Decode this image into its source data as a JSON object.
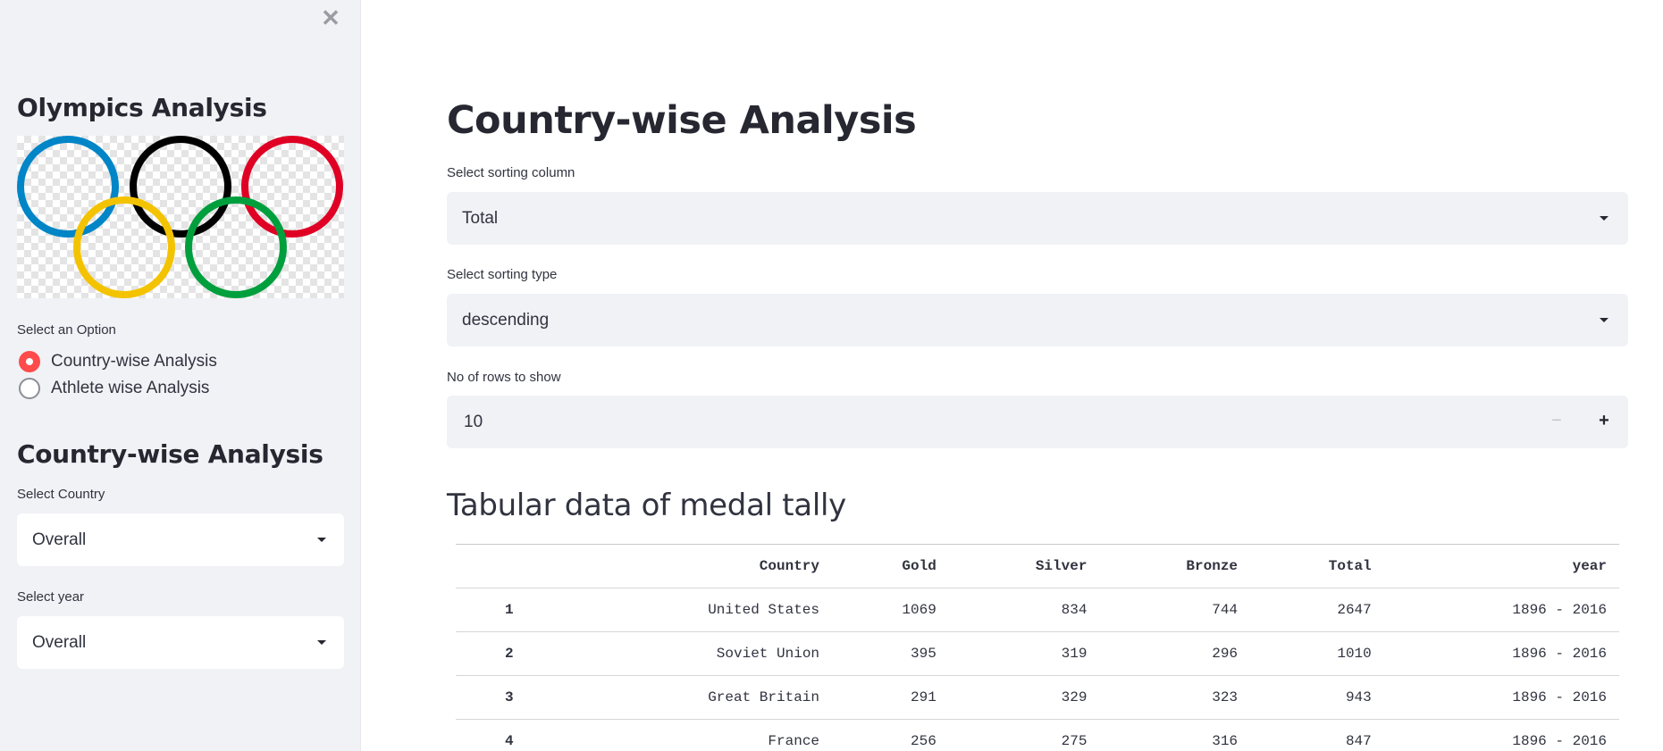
{
  "sidebar": {
    "close_glyph": "✕",
    "title": "Olympics Analysis",
    "option_label": "Select an Option",
    "options": [
      {
        "label": "Country-wise Analysis",
        "selected": true
      },
      {
        "label": "Athlete wise Analysis",
        "selected": false
      }
    ],
    "section_title": "Country-wise Analysis",
    "country_label": "Select Country",
    "country_value": "Overall",
    "year_label": "Select year",
    "year_value": "Overall"
  },
  "main": {
    "title": "Country-wise Analysis",
    "sort_column_label": "Select sorting column",
    "sort_column_value": "Total",
    "sort_type_label": "Select sorting type",
    "sort_type_value": "descending",
    "rows_label": "No of rows to show",
    "rows_value": "10",
    "minus": "−",
    "plus": "+",
    "table_title": "Tabular data of medal tally",
    "table": {
      "columns": [
        "",
        "Country",
        "Gold",
        "Silver",
        "Bronze",
        "Total",
        "year"
      ],
      "rows": [
        [
          "1",
          "United States",
          "1069",
          "834",
          "744",
          "2647",
          "1896 - 2016"
        ],
        [
          "2",
          "Soviet Union",
          "395",
          "319",
          "296",
          "1010",
          "1896 - 2016"
        ],
        [
          "3",
          "Great Britain",
          "291",
          "329",
          "323",
          "943",
          "1896 - 2016"
        ],
        [
          "4",
          "France",
          "256",
          "275",
          "316",
          "847",
          "1896 - 2016"
        ]
      ]
    }
  },
  "colors": {
    "accent": "#ff4b4b",
    "sidebar_bg": "#f0f2f6",
    "ring_blue": "#0085c7",
    "ring_yellow": "#f4c300",
    "ring_black": "#000000",
    "ring_green": "#009f3d",
    "ring_red": "#df0024"
  }
}
